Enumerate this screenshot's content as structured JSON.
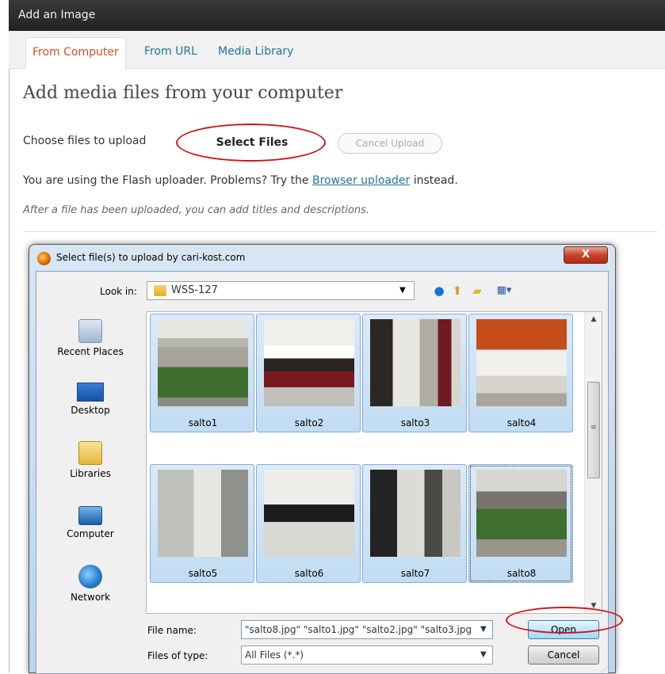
{
  "panel": {
    "title": "Add an Image",
    "tabs": [
      {
        "label": "From Computer",
        "active": true
      },
      {
        "label": "From URL",
        "active": false
      },
      {
        "label": "Media Library",
        "active": false
      }
    ],
    "heading": "Add media files from your computer",
    "choose_label": "Choose files to upload",
    "select_files_label": "Select Files",
    "cancel_upload_label": "Cancel Upload",
    "flash_note_prefix": "You are using the Flash uploader. Problems? Try the",
    "flash_note_link": "Browser uploader",
    "flash_note_suffix": "instead.",
    "after_note": "After a file has been uploaded, you can add titles and descriptions."
  },
  "dialog": {
    "title": "Select file(s) to upload by cari-kost.com",
    "close_label": "X",
    "look_in_label": "Look in:",
    "look_in_value": "WSS-127",
    "places": [
      {
        "label": "Recent Places",
        "icon": "recent-places-icon"
      },
      {
        "label": "Desktop",
        "icon": "desktop-icon"
      },
      {
        "label": "Libraries",
        "icon": "libraries-icon"
      },
      {
        "label": "Computer",
        "icon": "computer-icon"
      },
      {
        "label": "Network",
        "icon": "network-icon"
      }
    ],
    "files": [
      {
        "name": "salto1",
        "selected": true
      },
      {
        "name": "salto2",
        "selected": true
      },
      {
        "name": "salto3",
        "selected": true
      },
      {
        "name": "salto4",
        "selected": true
      },
      {
        "name": "salto5",
        "selected": true
      },
      {
        "name": "salto6",
        "selected": true
      },
      {
        "name": "salto7",
        "selected": true
      },
      {
        "name": "salto8",
        "selected": true,
        "focused": true
      }
    ],
    "file_name_label": "File name:",
    "file_name_value": "\"salto8.jpg\" \"salto1.jpg\" \"salto2.jpg\" \"salto3.jpg",
    "files_of_type_label": "Files of type:",
    "files_of_type_value": "All Files (*.*)",
    "open_label": "Open",
    "cancel_label": "Cancel"
  },
  "colors": {
    "header_bg": "#464646",
    "active_tab": "#d54e21",
    "link": "#21759b",
    "highlight_ellipse": "#d1121b",
    "selection_bg": "#c1dcf3"
  }
}
